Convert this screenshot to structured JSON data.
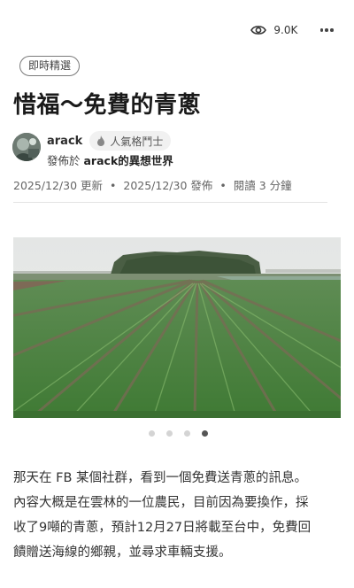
{
  "header": {
    "view_count": "9.0K",
    "icons": {
      "views": "eye-icon",
      "more": "more-dots-icon"
    }
  },
  "article": {
    "tag": "即時精選",
    "title": "惜福～免費的青蔥",
    "author": {
      "name": "arack",
      "badge": "人氣格鬥士",
      "badge_icon": "flame-icon",
      "published_prefix": "發佈於",
      "blog_name": "arack的異想世界"
    },
    "meta": {
      "updated": "2025/12/30 更新",
      "separator": "•",
      "published": "2025/12/30 發佈",
      "reading_time": "閱讀 3 分鐘"
    },
    "carousel": {
      "total": 4,
      "active_index": 3
    },
    "body_lines": [
      "那天在 FB 某個社群，看到一個免費送青蔥的訊息。",
      "內容大概是在雲林的一位農民，目前因為要換作，採",
      "收了9噸的青蔥，預計12月27日將載至台中，免費回",
      "饋贈送海線的鄉親，並尋求車輛支援。"
    ]
  },
  "colors": {
    "text_primary": "#1a1a1a",
    "text_secondary": "#666666",
    "dot_active": "#555555",
    "dot_inactive": "#d4d4d4",
    "badge_bg": "#f1f1f1"
  }
}
